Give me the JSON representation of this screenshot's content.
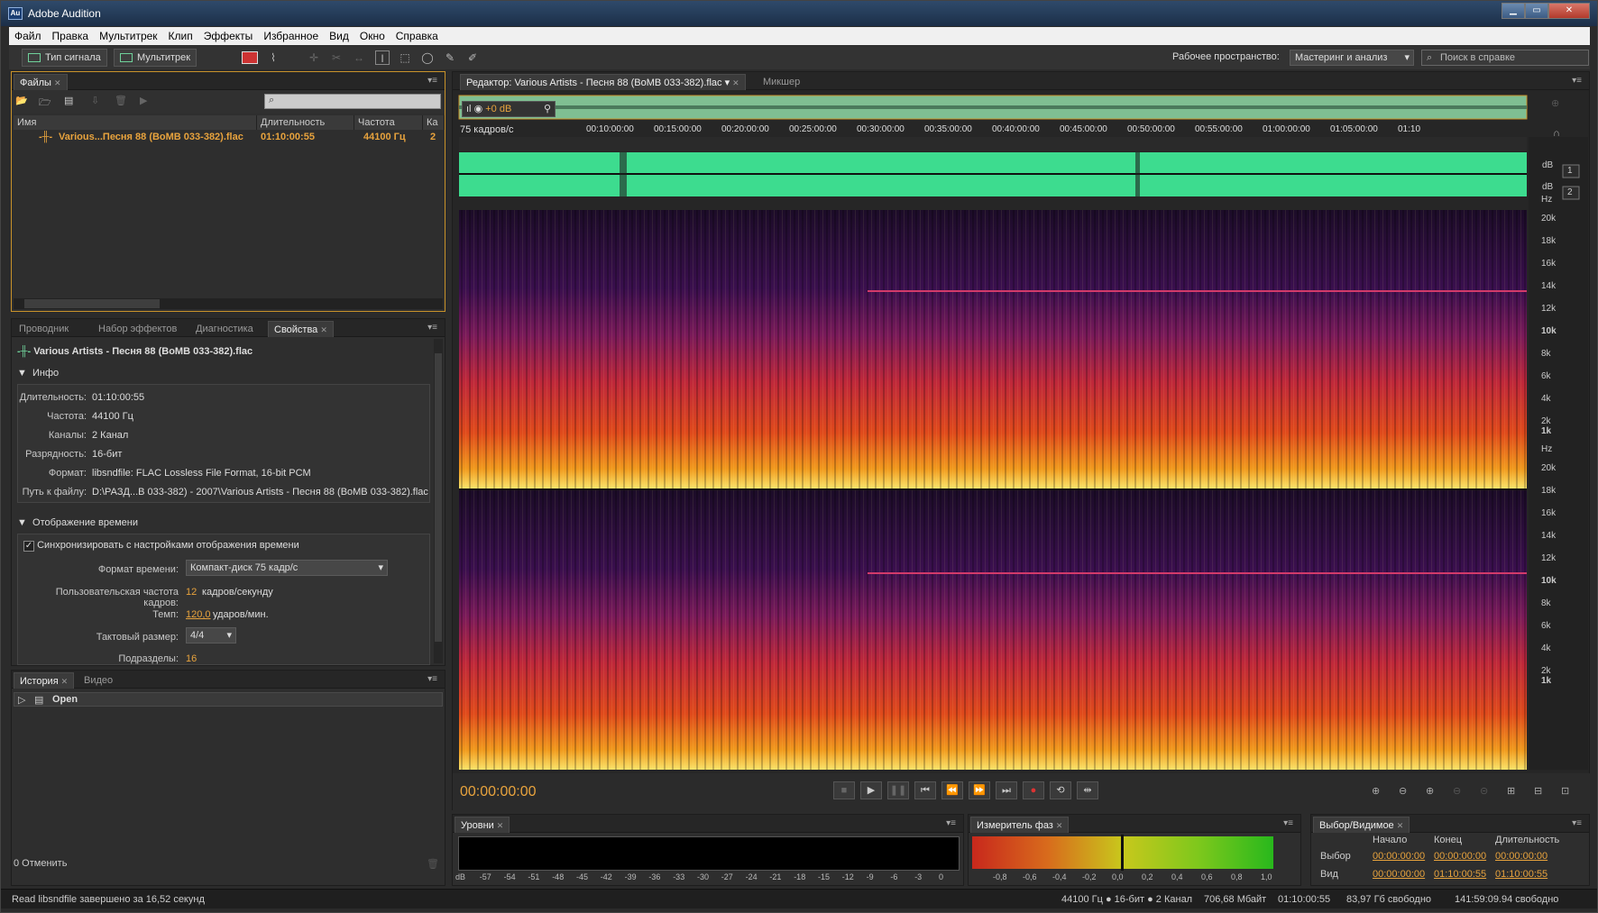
{
  "window": {
    "app_icon": "Au",
    "title": "Adobe Audition"
  },
  "menu": [
    "Файл",
    "Правка",
    "Мультитрек",
    "Клип",
    "Эффекты",
    "Избранное",
    "Вид",
    "Окно",
    "Справка"
  ],
  "toolbar": {
    "waveform_btn": "Тип сигнала",
    "multitrack_btn": "Мультитрек",
    "workspace_label": "Рабочее пространство:",
    "workspace_value": "Мастеринг и анализ",
    "help_search": "Поиск в справке"
  },
  "files_panel": {
    "tab": "Файлы",
    "columns": [
      "Имя",
      "Длительность",
      "Частота",
      "Ка"
    ],
    "rows": [
      {
        "name": "Various...Песня 88 (BoMB 033-382).flac",
        "duration": "01:10:00:55",
        "rate": "44100 Гц",
        "ch": "2"
      }
    ]
  },
  "props_panel": {
    "tabs": [
      "Проводник",
      "Набор эффектов",
      "Диагностика",
      "Свойства"
    ],
    "file_title": "Various Artists - Песня 88 (BoMB 033-382).flac",
    "info_header": "Инфо",
    "info": [
      {
        "label": "Длительность:",
        "value": "01:10:00:55"
      },
      {
        "label": "Частота:",
        "value": "44100 Гц"
      },
      {
        "label": "Каналы:",
        "value": "2 Канал"
      },
      {
        "label": "Разрядность:",
        "value": "16-бит"
      },
      {
        "label": "Формат:",
        "value": "libsndfile: FLAC Lossless File Format, 16-bit PCM"
      },
      {
        "label": "Путь к файлу:",
        "value": "D:\\РАЗД...В 033-382) - 2007\\Various Artists - Песня 88 (BoMB 033-382).flac"
      }
    ],
    "time_header": "Отображение времени",
    "sync_label": "Синхронизировать с настройками отображения времени",
    "time_format_label": "Формат времени:",
    "time_format_value": "Компакт-диск 75 кадр/с",
    "fps_label": "Пользовательская частота кадров:",
    "fps_value": "12",
    "fps_unit": "кадров/секунду",
    "tempo_label": "Темп:",
    "tempo_value": "120,0",
    "tempo_unit": "ударов/мин.",
    "meter_label": "Тактовый размер:",
    "meter_value": "4/4",
    "subdiv_label": "Подразделы:",
    "subdiv_value": "16"
  },
  "history_panel": {
    "tabs": [
      "История",
      "Видео"
    ],
    "item": "Open",
    "undo": "0 Отменить"
  },
  "editor": {
    "tab": "Редактор: Various Artists - Песня 88 (BoMB 033-382).flac",
    "mixer_tab": "Микшер",
    "gain": "+0 dB",
    "ruler_label": "75 кадров/с",
    "ruler_ticks": [
      "00:10:00:00",
      "00:15:00:00",
      "00:20:00:00",
      "00:25:00:00",
      "00:30:00:00",
      "00:35:00:00",
      "00:40:00:00",
      "00:45:00:00",
      "00:50:00:00",
      "00:55:00:00",
      "01:00:00:00",
      "01:05:00:00",
      "01:10"
    ],
    "db_label": "dB",
    "ch1": "1",
    "ch2": "2",
    "freq_labels": [
      "Hz",
      "20k",
      "18k",
      "16k",
      "14k",
      "12k",
      "10k",
      "8k",
      "6k",
      "4k",
      "2k",
      "1k"
    ],
    "time_display": "00:00:00:00"
  },
  "levels_panel": {
    "tab": "Уровни",
    "ticks": [
      "dB",
      "-57",
      "-54",
      "-51",
      "-48",
      "-45",
      "-42",
      "-39",
      "-36",
      "-33",
      "-30",
      "-27",
      "-24",
      "-21",
      "-18",
      "-15",
      "-12",
      "-9",
      "-6",
      "-3",
      "0"
    ]
  },
  "phase_panel": {
    "tab": "Измеритель фаз",
    "ticks": [
      "-0,8",
      "-0,6",
      "-0,4",
      "-0,2",
      "0,0",
      "0,2",
      "0,4",
      "0,6",
      "0,8",
      "1,0"
    ]
  },
  "selection_panel": {
    "tab": "Выбор/Видимое",
    "headers": [
      "Начало",
      "Конец",
      "Длительность"
    ],
    "rows": [
      {
        "label": "Выбор",
        "start": "00:00:00:00",
        "end": "00:00:00:00",
        "dur": "00:00:00:00"
      },
      {
        "label": "Вид",
        "start": "00:00:00:00",
        "end": "01:10:00:55",
        "dur": "01:10:00:55"
      }
    ]
  },
  "status": {
    "left": "Read libsndfile завершено за 16,52 секунд",
    "format": "44100 Гц ● 16-бит ● 2 Канал",
    "size": "706,68 Мбайт",
    "dur": "01:10:00:55",
    "free": "83,97 Гб свободно",
    "free_time": "141:59:09.94 свободно"
  }
}
